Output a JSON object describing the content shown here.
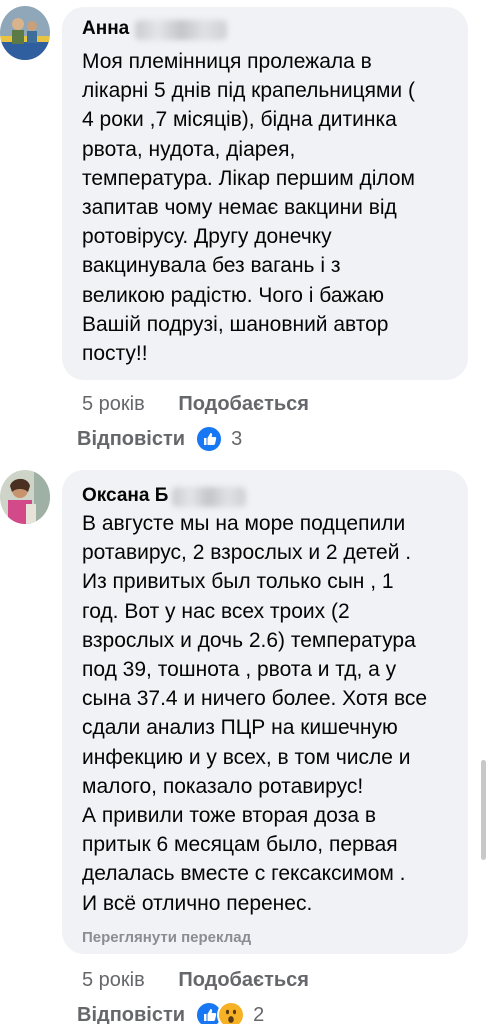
{
  "comments": [
    {
      "author_visible": "Анна",
      "text_lines": [
        "Моя племінниця  пролежала в",
        "лікарні 5 днів під крапельницями (",
        "4 роки ,7 місяців), бідна дитинка",
        "рвота, нудота, діарея,",
        "температура. Лікар першим ділом",
        "запитав чому немає вакцини від",
        "ротовірусу. Другу донечку",
        "вакцинувала без вагань і з",
        "великою радістю. Чого і бажаю",
        "Вашій подрузі, шановний автор",
        "посту!!"
      ],
      "time": "5 років",
      "like_label": "Подобається",
      "reply_label": "Відповісти",
      "reactions": [
        "like-icon"
      ],
      "reaction_count": "3"
    },
    {
      "author_visible": "Оксана Б",
      "text_lines": [
        "В августе мы на море подцепили",
        "ротавирус, 2 взрослых и 2 детей .",
        "Из привитых был только сын , 1",
        "год. Вот у нас всех троих (2",
        "взрослых и дочь 2.6) температура",
        "под 39, тошнота , рвота и тд, а у",
        "сына 37.4 и ничего более. Хотя все",
        "сдали анализ ПЦР на кишечную",
        "инфекцию и у всех, в том числе и",
        "малого, показало ротавирус!",
        "А привили тоже вторая доза в",
        "притык 6 месяцам было, первая",
        "делалась вместе с гексаксимом .",
        "И всё отлично  перенес."
      ],
      "translate_label": "Переглянути переклад",
      "time": "5 років",
      "like_label": "Подобається",
      "reply_label": "Відповісти",
      "reactions": [
        "like-icon",
        "wow-icon"
      ],
      "reaction_count": "2"
    }
  ],
  "colors": {
    "bubble": "#f0f2f5",
    "meta_text": "#65676b",
    "like_blue": "#1877f2",
    "wow_yellow": "#f7b125"
  }
}
